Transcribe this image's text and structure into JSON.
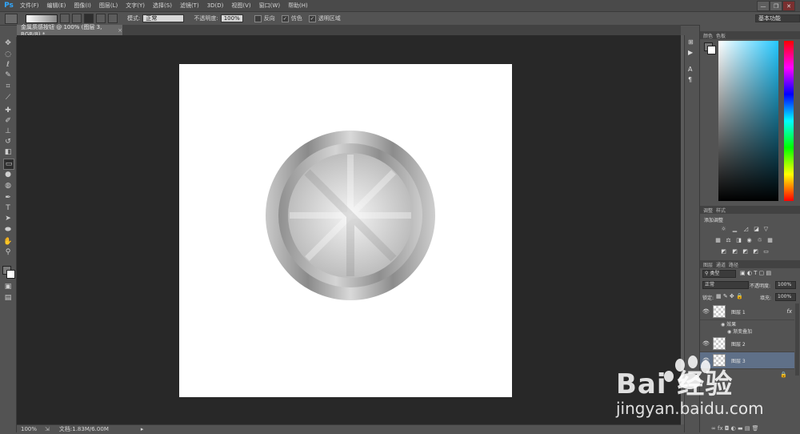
{
  "app": {
    "logo": "Ps"
  },
  "menu": [
    "文件(F)",
    "编辑(E)",
    "图像(I)",
    "图层(L)",
    "文字(Y)",
    "选择(S)",
    "滤镜(T)",
    "3D(D)",
    "视图(V)",
    "窗口(W)",
    "帮助(H)"
  ],
  "window_controls": [
    "—",
    "❐",
    "✕"
  ],
  "options": {
    "mode_label": "模式:",
    "mode_value": "正常",
    "opacity_label": "不透明度:",
    "opacity_value": "100%",
    "reverse_label": "反向",
    "dither_label": "仿色",
    "transparency_label": "透明区域",
    "workspace": "基本功能"
  },
  "document": {
    "tab_title": "金属质感按钮 @ 100% (图层 3, RGB/8) *"
  },
  "status": {
    "zoom": "100%",
    "doc_info": "文档:1.83M/6.00M"
  },
  "panels": {
    "color_tabs": [
      "颜色",
      "色板"
    ],
    "adjust_tabs": [
      "调整",
      "样式"
    ],
    "adjust_title": "添加调整",
    "layers_tabs": [
      "图层",
      "通道",
      "路径"
    ],
    "kind_label": "类型",
    "blend_mode": "正常",
    "opacity_label": "不透明度:",
    "opacity_value": "100%",
    "lock_label": "锁定:",
    "fill_label": "填充:",
    "fill_value": "100%",
    "layers": [
      {
        "name": "图层 1",
        "fx": "fx"
      },
      {
        "name": "图层 2"
      },
      {
        "name": "图层 3"
      }
    ],
    "effects_label": "效果",
    "effect_item": "渐变叠加"
  },
  "watermark": {
    "brand": "Bai 经验",
    "url": "jingyan.baidu.com"
  },
  "colors": {
    "accent": "#31a8ff",
    "selected_layer": "#5f7088",
    "canvas_area": "#282828"
  }
}
